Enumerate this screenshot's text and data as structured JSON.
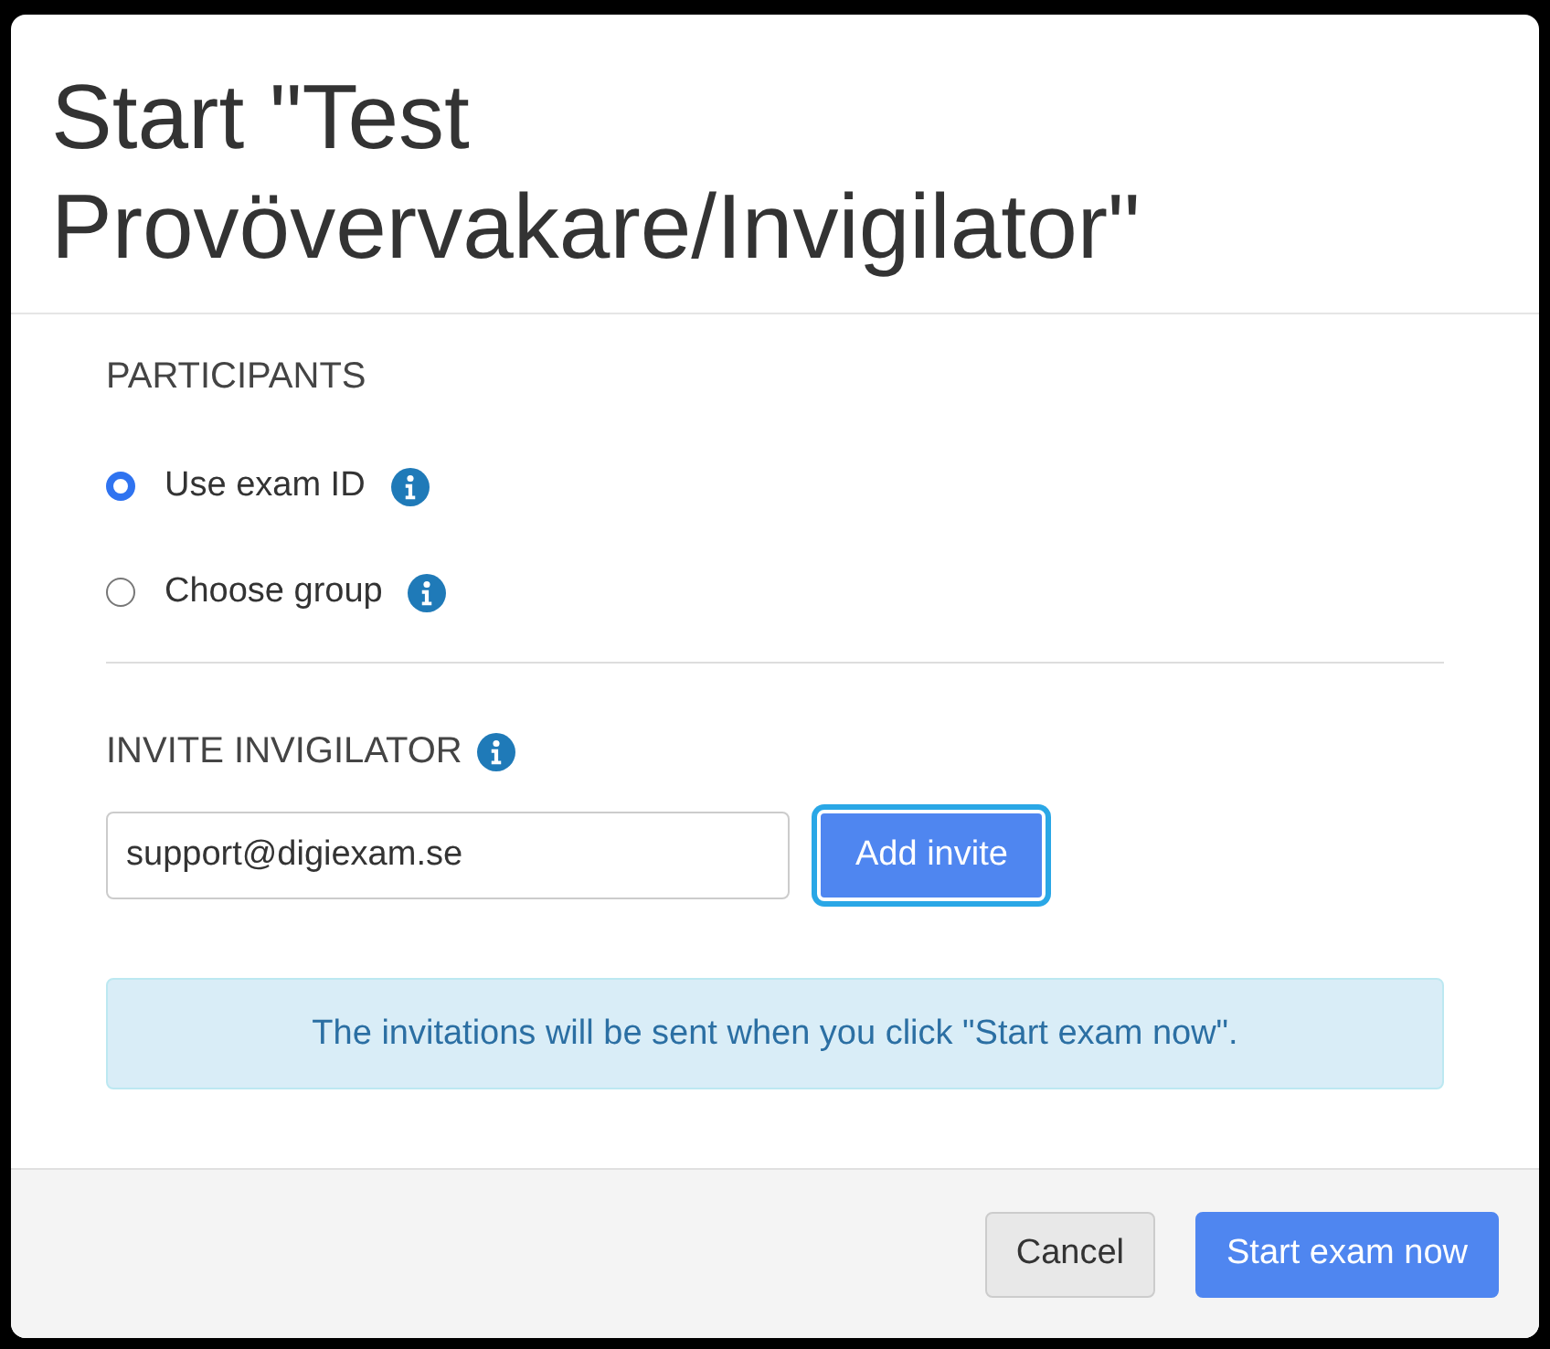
{
  "dialog": {
    "title": "Start \"Test Provövervakare/Invigilator\""
  },
  "participants": {
    "heading": "PARTICIPANTS",
    "options": [
      {
        "label": "Use exam ID",
        "selected": true
      },
      {
        "label": "Choose group",
        "selected": false
      }
    ]
  },
  "invite": {
    "heading": "INVITE INVIGILATOR",
    "email": {
      "value": "support@digiexam.se"
    },
    "button": {
      "label": "Add invite",
      "focused": true
    }
  },
  "notice": "The invitations will be sent when you click \"Start exam now\".",
  "footer": {
    "buttons": [
      {
        "label": "Cancel",
        "kind": "default"
      },
      {
        "label": "Start exam now",
        "kind": "primary"
      }
    ]
  }
}
